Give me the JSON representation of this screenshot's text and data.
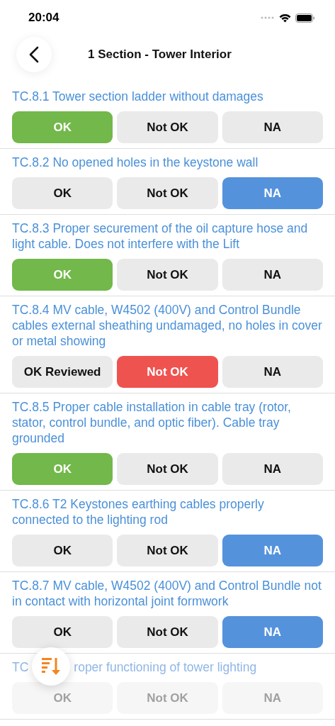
{
  "status_bar": {
    "time": "20:04"
  },
  "header": {
    "title": "1 Section - Tower Interior"
  },
  "items": [
    {
      "title": "TC.8.1 Tower section ladder without damages",
      "faded": false,
      "options": [
        {
          "kind": "ok",
          "label": "OK",
          "selected": true
        },
        {
          "kind": "not_ok",
          "label": "Not OK",
          "selected": false
        },
        {
          "kind": "na",
          "label": "NA",
          "selected": false
        }
      ]
    },
    {
      "title": "TC.8.2 No opened holes in the keystone wall",
      "faded": false,
      "options": [
        {
          "kind": "ok",
          "label": "OK",
          "selected": false
        },
        {
          "kind": "not_ok",
          "label": "Not OK",
          "selected": false
        },
        {
          "kind": "na",
          "label": "NA",
          "selected": true
        }
      ]
    },
    {
      "title": "TC.8.3 Proper securement of the oil capture hose and light cable.  Does not interfere with the Lift",
      "faded": false,
      "options": [
        {
          "kind": "ok",
          "label": "OK",
          "selected": true
        },
        {
          "kind": "not_ok",
          "label": "Not OK",
          "selected": false
        },
        {
          "kind": "na",
          "label": "NA",
          "selected": false
        }
      ]
    },
    {
      "title": "TC.8.4 MV cable, W4502 (400V) and Control Bundle cables external sheathing undamaged, no holes in cover or metal showing",
      "faded": false,
      "options": [
        {
          "kind": "ok",
          "label": "OK Reviewed",
          "selected": false
        },
        {
          "kind": "not_ok",
          "label": "Not OK",
          "selected": true
        },
        {
          "kind": "na",
          "label": "NA",
          "selected": false
        }
      ]
    },
    {
      "title": "TC.8.5 Proper cable installation in cable tray (rotor, stator, control bundle, and optic fiber). Cable tray grounded",
      "faded": false,
      "options": [
        {
          "kind": "ok",
          "label": "OK",
          "selected": true
        },
        {
          "kind": "not_ok",
          "label": "Not OK",
          "selected": false
        },
        {
          "kind": "na",
          "label": "NA",
          "selected": false
        }
      ]
    },
    {
      "title": "TC.8.6 T2 Keystones earthing cables properly connected to the lighting rod",
      "faded": false,
      "options": [
        {
          "kind": "ok",
          "label": "OK",
          "selected": false
        },
        {
          "kind": "not_ok",
          "label": "Not OK",
          "selected": false
        },
        {
          "kind": "na",
          "label": "NA",
          "selected": true
        }
      ]
    },
    {
      "title": "TC.8.7 MV cable, W4502 (400V) and Control Bundle not in contact with horizontal joint formwork",
      "faded": false,
      "options": [
        {
          "kind": "ok",
          "label": "OK",
          "selected": false
        },
        {
          "kind": "not_ok",
          "label": "Not OK",
          "selected": false
        },
        {
          "kind": "na",
          "label": "NA",
          "selected": true
        }
      ]
    },
    {
      "title_parts": [
        "TC",
        "roper functioning of tower lighting"
      ],
      "faded": true,
      "options": [
        {
          "kind": "ok",
          "label": "OK",
          "selected": false
        },
        {
          "kind": "not_ok",
          "label": "Not OK",
          "selected": false
        },
        {
          "kind": "na",
          "label": "NA",
          "selected": false
        }
      ]
    }
  ]
}
